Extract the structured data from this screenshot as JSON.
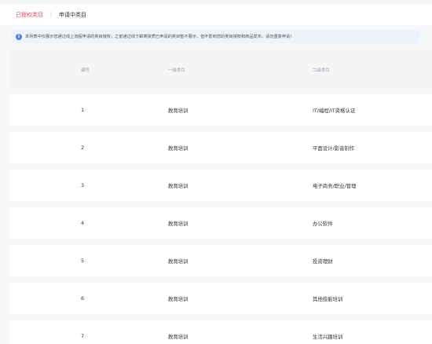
{
  "tabs": {
    "authorized": "已授权类目",
    "separator": "|",
    "applying": "申请中类目"
  },
  "notice": {
    "icon": "info-icon",
    "text": "本列表中仅展示您通过线上流程申请的类目授权，之前通过线下邮寄资质已申请的类目暂不展示，但不影响您的类目授权和商品发布，请勿重复申请!"
  },
  "table": {
    "headers": [
      "编号",
      "一级类目",
      "二级类目"
    ],
    "rows": [
      {
        "id": "1",
        "level1": "教育培训",
        "level2": "IT/编程/IT资格认证"
      },
      {
        "id": "2",
        "level1": "教育培训",
        "level2": "平面设计/影音制作"
      },
      {
        "id": "3",
        "level1": "教育培训",
        "level2": "电子商务/职业/管理"
      },
      {
        "id": "4",
        "level1": "教育培训",
        "level2": "办公软件"
      },
      {
        "id": "5",
        "level1": "教育培训",
        "level2": "投资理财"
      },
      {
        "id": "6",
        "level1": "教育培训",
        "level2": "其他技能培训"
      },
      {
        "id": "7",
        "level1": "教育培训",
        "level2": "生活兴趣培训"
      }
    ]
  },
  "colors": {
    "active_tab": "#f5475e",
    "info_icon": "#4f7fdd",
    "notice_bg": "#eef3fb"
  }
}
